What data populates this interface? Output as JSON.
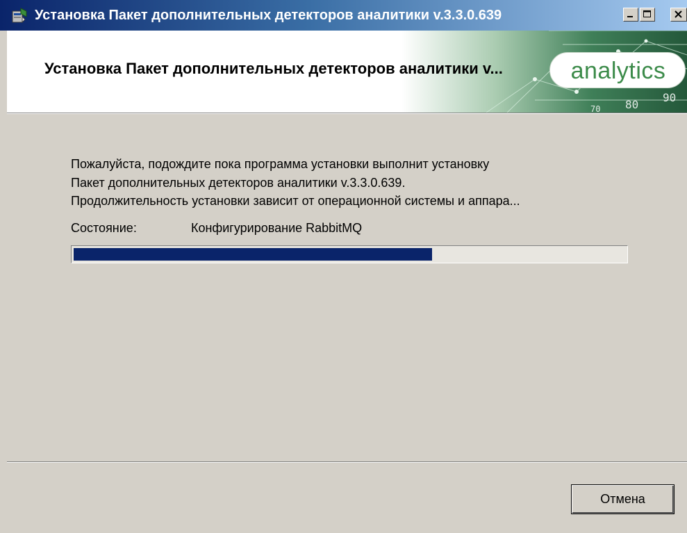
{
  "window": {
    "title": "Установка Пакет дополнительных детекторов аналитики v.3.3.0.639"
  },
  "banner": {
    "title": "Установка Пакет дополнительных детекторов аналитики v...",
    "logo_text": "analytics"
  },
  "content": {
    "lines": [
      "Пожалуйста, подождите пока программа установки выполнит установку",
      "Пакет дополнительных детекторов аналитики v.3.3.0.639.",
      "Продолжительность установки зависит от операционной системы и аппара..."
    ],
    "status_label": "Состояние:",
    "status_value": "Конфигурирование RabbitMQ",
    "progress": 0.65
  },
  "footer": {
    "cancel_label": "Отмена"
  },
  "colors": {
    "titlebar_start": "#0a246a",
    "titlebar_end": "#a6caf0",
    "progress_fill": "#0a246a",
    "dialog_background": "#d4d0c8",
    "logo_green": "#3c8b4a"
  }
}
